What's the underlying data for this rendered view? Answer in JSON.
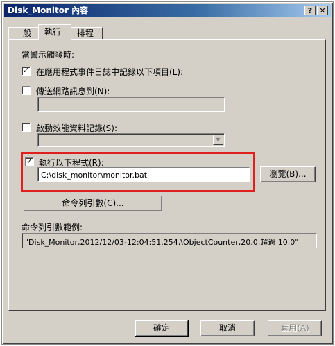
{
  "window": {
    "title": "Disk_Monitor 內容",
    "help_glyph": "?",
    "close_glyph": "✕"
  },
  "tabs": [
    {
      "label": "一般"
    },
    {
      "label": "執行"
    },
    {
      "label": "排程"
    }
  ],
  "panel": {
    "section_heading": "當警示觸發時:",
    "log_event": {
      "checked_glyph": "✓",
      "label": "在應用程式事件日誌中記錄以下項目(L):"
    },
    "send_message": {
      "checked_glyph": "",
      "label": "傳送網路訊息到(N):",
      "value": ""
    },
    "perf_log": {
      "checked_glyph": "",
      "label": "啟動效能資料記錄(S):",
      "value": "",
      "arrow": "▼"
    },
    "run_program": {
      "checked_glyph": "✓",
      "label": "執行以下程式(R):",
      "path": "C:\\disk_monitor\\monitor.bat",
      "browse_label": "瀏覽(B)..."
    },
    "args_button_label": "命令列引數(C)...",
    "example_heading": "命令列引數範例:",
    "example_value": "\"Disk_Monitor,2012/12/03-12:04:51.254,\\ObjectCounter,20.0,超過 10.0\""
  },
  "footer": {
    "ok_label": "確定",
    "cancel_label": "取消",
    "apply_label": "套用(A)"
  },
  "colors": {
    "highlight": "#e21f1f",
    "face": "#d4d0c8",
    "title_start": "#0a246a"
  }
}
